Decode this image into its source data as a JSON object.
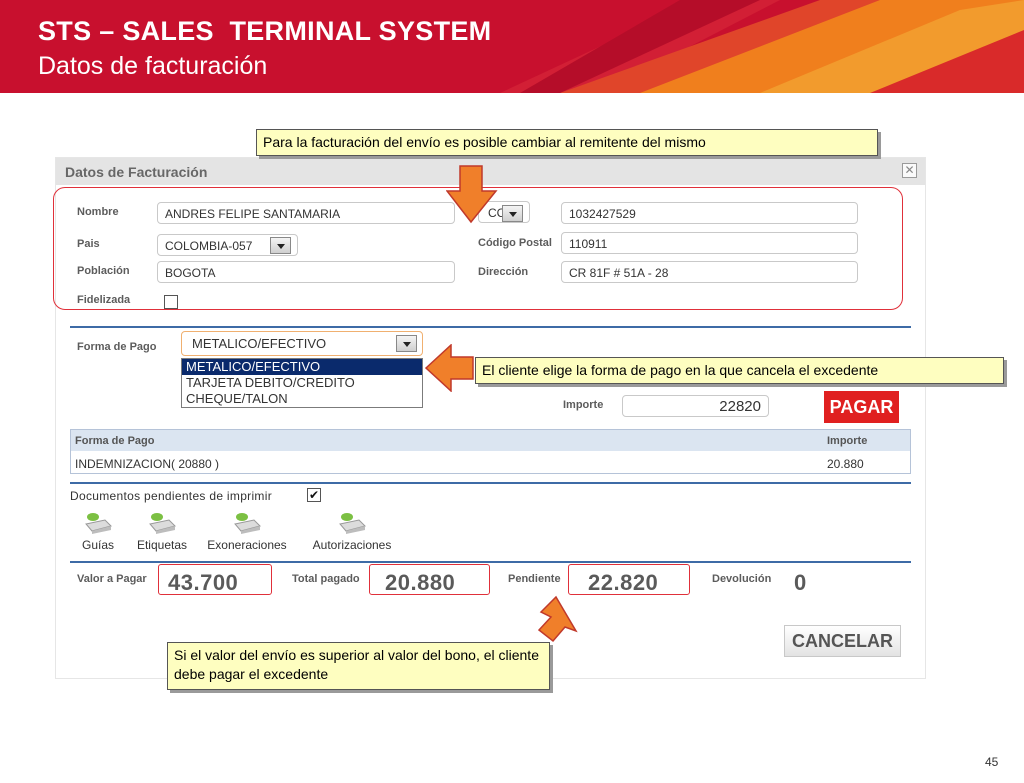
{
  "header": {
    "title": "STS – SALES  TERMINAL SYSTEM",
    "subtitle": "Datos de facturación"
  },
  "dialog": {
    "title": "Datos de Facturación",
    "close_glyph": "✕"
  },
  "form": {
    "nombre_label": "Nombre",
    "nombre_value": "ANDRES FELIPE SANTAMARIA",
    "doc_type_value": "CC",
    "doc_number_value": "1032427529",
    "pais_label": "Pais",
    "pais_value": "COLOMBIA-057",
    "codigo_postal_label": "Código Postal",
    "codigo_postal_value": "110911",
    "poblacion_label": "Población",
    "poblacion_value": "BOGOTA",
    "direccion_label": "Dirección",
    "direccion_value": "CR 81F # 51A - 28",
    "fidelizada_label": "Fidelizada"
  },
  "payment": {
    "forma_pago_label": "Forma de Pago",
    "selected": "METALICO/EFECTIVO",
    "options": [
      "METALICO/EFECTIVO",
      "TARJETA DEBITO/CREDITO",
      "CHEQUE/TALON"
    ],
    "importe_label": "Importe",
    "importe_value": "22820",
    "pagar_label": "PAGAR"
  },
  "table": {
    "headers": [
      "Forma de Pago",
      "Importe"
    ],
    "rows": [
      [
        "INDEMNIZACION( 20880 )",
        "20.880"
      ]
    ]
  },
  "documents": {
    "label": "Documentos pendientes de imprimir",
    "checked_glyph": "✔",
    "items": [
      "Guías",
      "Etiquetas",
      "Exoneraciones",
      "Autorizaciones"
    ]
  },
  "totals": {
    "valor_label": "Valor a Pagar",
    "valor_value": "43.700",
    "total_label": "Total pagado",
    "total_value": "20.880",
    "pendiente_label": "Pendiente",
    "pendiente_value": "22.820",
    "devolucion_label": "Devolución",
    "devolucion_value": "0"
  },
  "cancelar_label": "CANCELAR",
  "callouts": {
    "top": "Para la facturación del envío es posible cambiar al remitente del mismo",
    "right": "El cliente elige la forma de pago en la que cancela el excedente",
    "bottom": "Si el valor del envío es superior al valor del bono, el cliente debe pagar el excedente"
  },
  "page_number": "45",
  "colors": {
    "header_red": "#c8102e",
    "header_orange": "#f07f1d",
    "accent_red": "#e0303a",
    "arrow_orange": "#f07f2a",
    "callout_yellow": "#fefec0",
    "divider_blue": "#3d6ba6"
  }
}
